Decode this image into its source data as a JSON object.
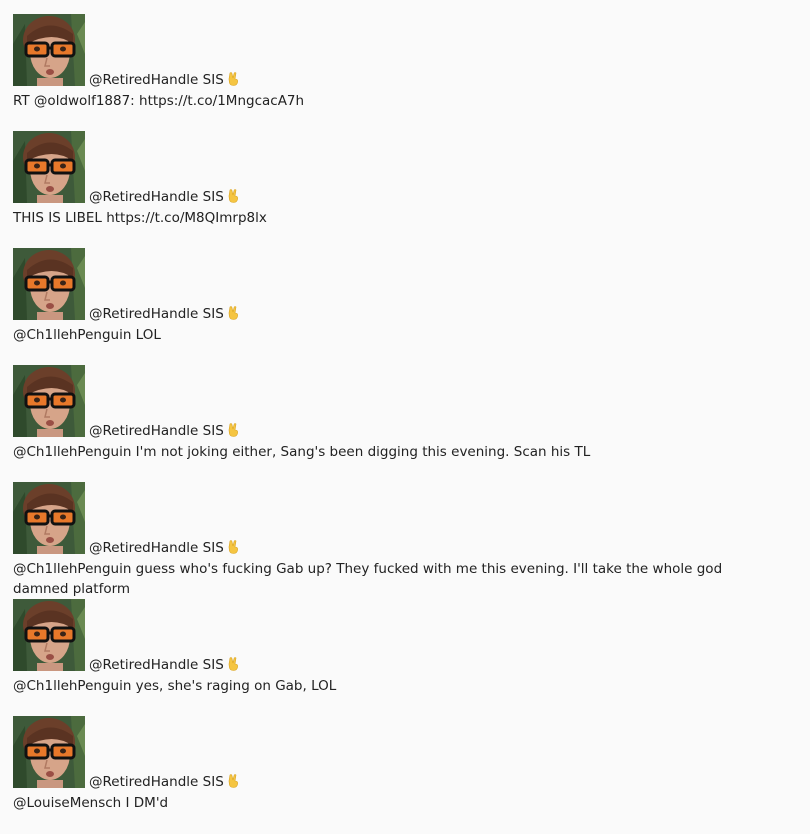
{
  "feed": {
    "tweets": [
      {
        "handle": "@RetiredHandle SIS",
        "text": "RT @oldwolf1887: https://t.co/1MngcacA7h",
        "icon": "victory-hand-icon"
      },
      {
        "handle": "@RetiredHandle SIS",
        "text": "THIS IS LIBEL https://t.co/M8QImrp8lx",
        "icon": "victory-hand-icon"
      },
      {
        "handle": "@RetiredHandle SIS",
        "text": "@Ch1llehPenguin LOL",
        "icon": "victory-hand-icon"
      },
      {
        "handle": "@RetiredHandle SIS",
        "text": "@Ch1llehPenguin I'm not joking either, Sang's been digging this evening. Scan his TL",
        "icon": "victory-hand-icon"
      },
      {
        "handle": "@RetiredHandle SIS",
        "text": "@Ch1llehPenguin guess who's fucking Gab up? They fucked with me this evening. I'll take the whole god damned platform",
        "icon": "victory-hand-icon"
      },
      {
        "handle": "@RetiredHandle SIS",
        "text": "@Ch1llehPenguin yes, she's raging on Gab, LOL",
        "icon": "victory-hand-icon"
      },
      {
        "handle": "@RetiredHandle SIS",
        "text": "@LouiseMensch I DM'd",
        "icon": "victory-hand-icon"
      }
    ]
  },
  "colors": {
    "background": "#fafafa",
    "text": "#222222",
    "glasses_tint": "#e8782a",
    "hand_icon": "#f5c542"
  }
}
